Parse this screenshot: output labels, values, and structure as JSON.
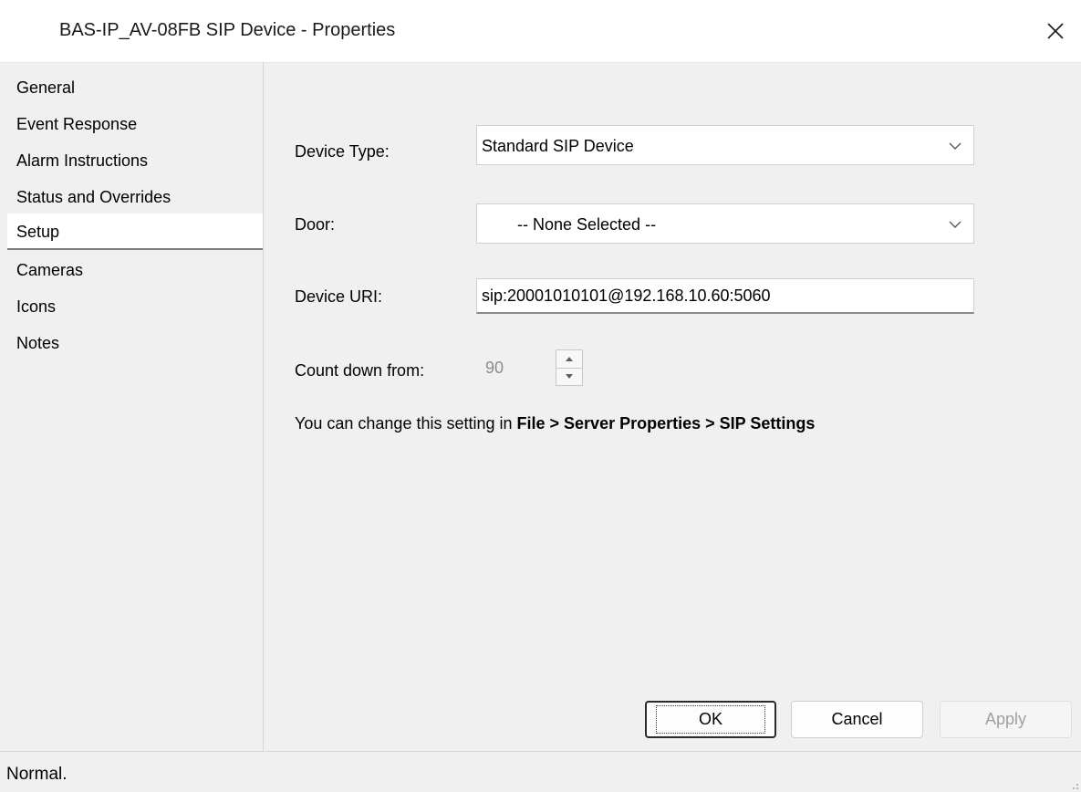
{
  "window": {
    "title": "BAS-IP_AV-08FB SIP Device - Properties",
    "close_icon": "close-icon"
  },
  "sidebar": {
    "items": [
      {
        "label": "General"
      },
      {
        "label": "Event Response"
      },
      {
        "label": "Alarm Instructions"
      },
      {
        "label": "Status and Overrides"
      },
      {
        "label": "Setup",
        "selected": true
      },
      {
        "label": "Cameras"
      },
      {
        "label": "Icons"
      },
      {
        "label": "Notes"
      }
    ]
  },
  "form": {
    "device_type": {
      "label": "Device Type:",
      "value": "Standard SIP Device"
    },
    "door": {
      "label": "Door:",
      "value": "-- None Selected --"
    },
    "device_uri": {
      "label": "Device URI:",
      "value": "sip:20001010101@192.168.10.60:5060"
    },
    "count_down": {
      "label": "Count down from:",
      "value": "90"
    },
    "hint": {
      "prefix": "You can change this setting in ",
      "path": "File > Server Properties > SIP Settings"
    }
  },
  "buttons": {
    "ok": "OK",
    "cancel": "Cancel",
    "apply": "Apply"
  },
  "status": {
    "text": "Normal."
  }
}
